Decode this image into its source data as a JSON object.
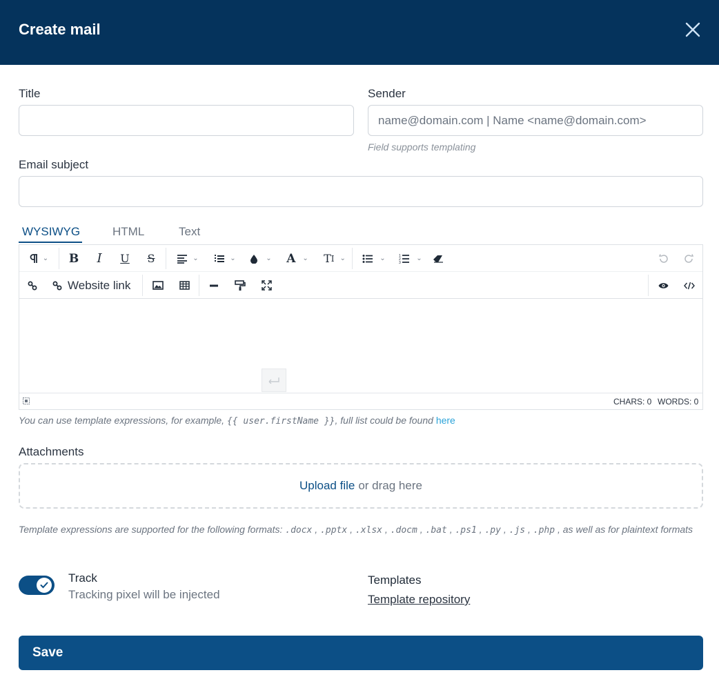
{
  "header": {
    "title": "Create mail"
  },
  "form": {
    "title_label": "Title",
    "title_value": "",
    "sender_label": "Sender",
    "sender_placeholder": "name@domain.com | Name <name@domain.com>",
    "sender_hint": "Field supports templating",
    "subject_label": "Email subject",
    "subject_value": ""
  },
  "tabs": [
    {
      "label": "WYSIWYG",
      "active": true
    },
    {
      "label": "HTML",
      "active": false
    },
    {
      "label": "Text",
      "active": false
    }
  ],
  "toolbar": {
    "paragraph_icon": "paragraph-icon",
    "bold_label": "B",
    "italic_label": "I",
    "underline_label": "U",
    "strike_label": "S",
    "font_label": "A",
    "font_size_label": "T",
    "website_link_label": "Website link"
  },
  "status": {
    "chars": "CHARS: 0",
    "words": "WORDS: 0"
  },
  "help": {
    "prefix": "You can use template expressions, for example, ",
    "example": "{{ user.firstName }}",
    "suffix": ", full list could be found ",
    "link": "here"
  },
  "attachments": {
    "label": "Attachments",
    "upload_link": "Upload file",
    "upload_rest": "or drag here",
    "formats_prefix": "Template expressions are supported for the following formats: ",
    "formats": [
      ".docx",
      ".pptx",
      ".xlsx",
      ".docm",
      ".bat",
      ".ps1",
      ".py",
      ".js",
      ".php"
    ],
    "formats_suffix": ", as well as for plaintext formats"
  },
  "track": {
    "title": "Track",
    "description": "Tracking pixel will be injected",
    "enabled": true
  },
  "templates": {
    "title": "Templates",
    "link": "Template repository"
  },
  "save_label": "Save",
  "colors": {
    "header": "#05335c",
    "accent": "#0c4f86",
    "link": "#2ba3d9"
  }
}
